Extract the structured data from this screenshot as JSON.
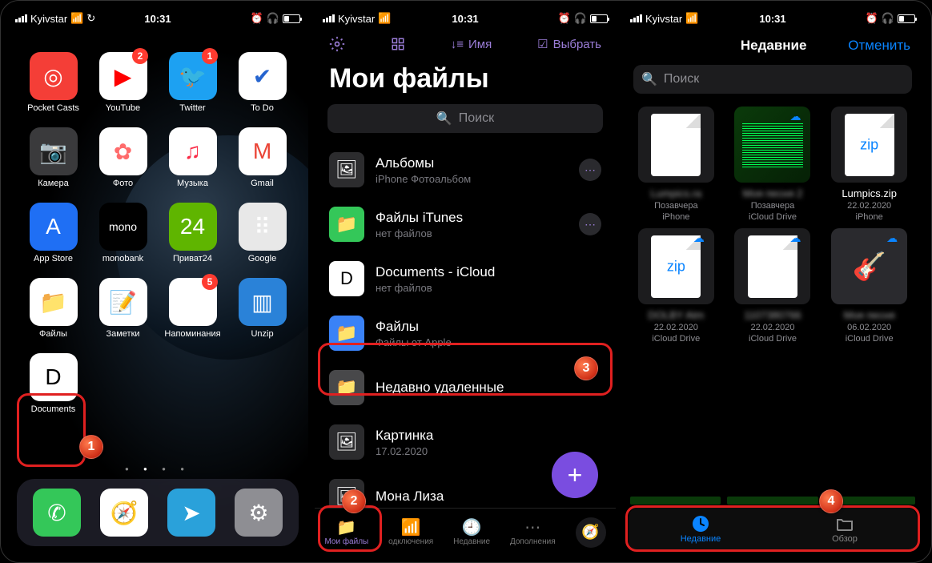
{
  "status": {
    "carrier": "Kyivstar",
    "time": "10:31"
  },
  "home": {
    "apps": [
      {
        "label": "Pocket Casts",
        "bg": "#f43e37",
        "glyph": "◎",
        "badge": null
      },
      {
        "label": "YouTube",
        "bg": "#ffffff",
        "glyph": "▶",
        "badge": "2",
        "glyphColor": "#ff0000"
      },
      {
        "label": "Twitter",
        "bg": "#1da1f2",
        "glyph": "🐦",
        "badge": "1"
      },
      {
        "label": "To Do",
        "bg": "#ffffff",
        "glyph": "✔",
        "glyphColor": "#2564cf"
      },
      {
        "label": "Камера",
        "bg": "#3a3a3c",
        "glyph": "📷"
      },
      {
        "label": "Фото",
        "bg": "#ffffff",
        "glyph": "✿",
        "glyphColor": "#ff6b6b"
      },
      {
        "label": "Музыка",
        "bg": "#ffffff",
        "glyph": "♫",
        "glyphColor": "#fa2d48"
      },
      {
        "label": "Gmail",
        "bg": "#ffffff",
        "glyph": "M",
        "glyphColor": "#ea4335"
      },
      {
        "label": "App Store",
        "bg": "#1f6ff4",
        "glyph": "A"
      },
      {
        "label": "monobank",
        "bg": "#000000",
        "glyph": "mono",
        "glyphSize": "14px"
      },
      {
        "label": "Приват24",
        "bg": "#5fb500",
        "glyph": "24"
      },
      {
        "label": "Google",
        "bg": "#e8e8e8",
        "glyph": "⠿"
      },
      {
        "label": "Файлы",
        "bg": "#ffffff",
        "glyph": "📁",
        "glyphColor": "#1e90ff"
      },
      {
        "label": "Заметки",
        "bg": "#ffffff",
        "glyph": "📝"
      },
      {
        "label": "Напоминания",
        "bg": "#ffffff",
        "glyph": "☰",
        "badge": "5"
      },
      {
        "label": "Unzip",
        "bg": "#2a82d8",
        "glyph": "▥"
      },
      {
        "label": "Documents",
        "bg": "#ffffff",
        "glyph": "D",
        "glyphColor": "#000"
      }
    ],
    "dock": [
      {
        "name": "phone",
        "bg": "#34c759",
        "glyph": "✆"
      },
      {
        "name": "safari",
        "bg": "#ffffff",
        "glyph": "🧭"
      },
      {
        "name": "telegram",
        "bg": "#2aa1da",
        "glyph": "➤"
      },
      {
        "name": "settings",
        "bg": "#8e8e93",
        "glyph": "⚙"
      }
    ]
  },
  "docs": {
    "title": "Мои файлы",
    "toolbar": {
      "sort_label": "Имя",
      "select_label": "Выбрать"
    },
    "search_placeholder": "Поиск",
    "rows": [
      {
        "title": "Альбомы",
        "sub": "iPhone Фотоальбом",
        "iconBg": "#2c2c2e",
        "icon": "🖼",
        "more": true
      },
      {
        "title": "Файлы iTunes",
        "sub": "нет файлов",
        "iconBg": "#34c759",
        "icon": "📁",
        "more": true
      },
      {
        "title": "Documents - iCloud",
        "sub": "нет файлов",
        "iconBg": "#ffffff",
        "icon": "D",
        "iconColor": "#000"
      },
      {
        "title": "Файлы",
        "sub": "Файлы от Apple",
        "iconBg": "#3a82f7",
        "icon": "📁"
      },
      {
        "title": "Недавно удаленные",
        "sub": "",
        "iconBg": "#48484a",
        "icon": "📁"
      },
      {
        "title": "Картинка",
        "sub": "17.02.2020",
        "iconBg": "#2c2c2e",
        "icon": "🖼"
      },
      {
        "title": "Мона Лиза",
        "sub": "",
        "iconBg": "#2c2c2e",
        "icon": "🖼"
      }
    ],
    "tabs": [
      {
        "label": "Мои файлы",
        "icon": "📁",
        "active": true
      },
      {
        "label": "одключения",
        "icon": "📶"
      },
      {
        "label": "Недавние",
        "icon": "🕘"
      },
      {
        "label": "Дополнения",
        "icon": "⋯"
      }
    ]
  },
  "picker": {
    "header_title": "Недавние",
    "cancel": "Отменить",
    "search_placeholder": "Поиск",
    "items": [
      {
        "name": "Lumpics.ra",
        "sub1": "Позавчера",
        "sub2": "iPhone",
        "type": "doc",
        "blurred": true,
        "cloud": false
      },
      {
        "name": "Моя песня 2",
        "sub1": "Позавчера",
        "sub2": "iCloud Drive",
        "type": "green",
        "blurred": true,
        "cloud": true
      },
      {
        "name": "Lumpics.zip",
        "sub1": "22.02.2020",
        "sub2": "iPhone",
        "type": "zip",
        "cloud": false
      },
      {
        "name": "DOLBY Atm",
        "sub1": "22.02.2020",
        "sub2": "iCloud Drive",
        "type": "zip",
        "blurred": true,
        "cloud": true
      },
      {
        "name": "1107380766",
        "sub1": "22.02.2020",
        "sub2": "iCloud Drive",
        "type": "doc",
        "blurred": true,
        "cloud": true
      },
      {
        "name": "Моя песня",
        "sub1": "06.02.2020",
        "sub2": "iCloud Drive",
        "type": "garage",
        "blurred": true,
        "cloud": true
      }
    ],
    "tabs": [
      {
        "label": "Недавние",
        "icon": "🕘",
        "active": true
      },
      {
        "label": "Обзор",
        "icon": "📁"
      }
    ]
  },
  "markers": {
    "m1": "1",
    "m2": "2",
    "m3": "3",
    "m4": "4"
  }
}
